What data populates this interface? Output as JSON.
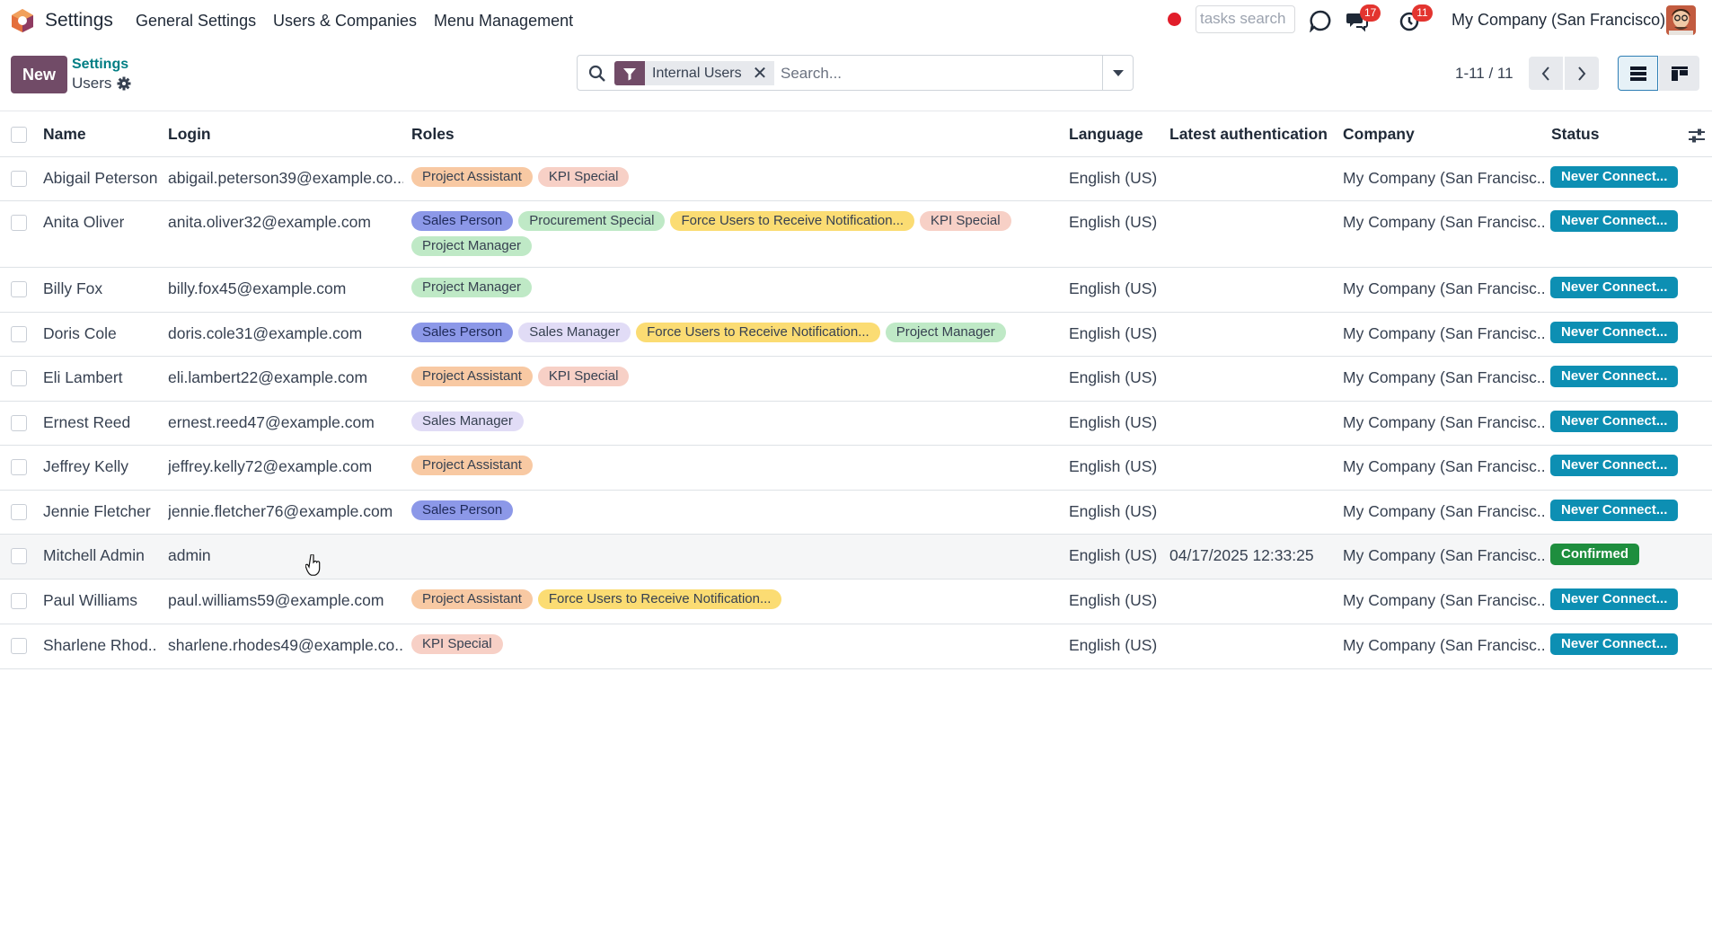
{
  "navbar": {
    "app_name": "Settings",
    "menus": [
      "General Settings",
      "Users & Companies",
      "Menu Management"
    ],
    "tasks_search_placeholder": "tasks search",
    "messages_count": "17",
    "activities_count": "11",
    "company": "My Company (San Francisco)"
  },
  "control_panel": {
    "new_label": "New",
    "breadcrumb": "Settings",
    "title": "Users",
    "facet_label": "Internal Users",
    "search_placeholder": "Search...",
    "pager": "1-11 / 11"
  },
  "columns": {
    "name": "Name",
    "login": "Login",
    "roles": "Roles",
    "language": "Language",
    "latest_auth": "Latest authentication",
    "company": "Company",
    "status": "Status"
  },
  "tag_colors": {
    "orange": "#f8c9a3",
    "salmon": "#f7d0c6",
    "blue": "#8c98e8",
    "green": "#bfe9c6",
    "yellow": "#fbdc73",
    "lavender": "#e1dcf6"
  },
  "status_colors": {
    "never": "#0d8fb3",
    "confirmed": "#1e8e3e"
  },
  "rows": [
    {
      "name": "Abigail Peterson",
      "login": "abigail.peterson39@example.co...",
      "roles": [
        {
          "label": "Project Assistant",
          "color": "orange"
        },
        {
          "label": "KPI Special",
          "color": "salmon"
        }
      ],
      "language": "English (US)",
      "latest_auth": "",
      "company": "My Company (San Francisc...",
      "status": "Never Connect...",
      "status_type": "never"
    },
    {
      "name": "Anita Oliver",
      "login": "anita.oliver32@example.com",
      "roles": [
        {
          "label": "Sales Person",
          "color": "blue"
        },
        {
          "label": "Procurement Special",
          "color": "green"
        },
        {
          "label": "Force Users to Receive Notification...",
          "color": "yellow"
        },
        {
          "label": "KPI Special",
          "color": "salmon"
        },
        {
          "label": "Project Manager",
          "color": "green"
        }
      ],
      "language": "English (US)",
      "latest_auth": "",
      "company": "My Company (San Francisc...",
      "status": "Never Connect...",
      "status_type": "never"
    },
    {
      "name": "Billy Fox",
      "login": "billy.fox45@example.com",
      "roles": [
        {
          "label": "Project Manager",
          "color": "green"
        }
      ],
      "language": "English (US)",
      "latest_auth": "",
      "company": "My Company (San Francisc...",
      "status": "Never Connect...",
      "status_type": "never"
    },
    {
      "name": "Doris Cole",
      "login": "doris.cole31@example.com",
      "roles": [
        {
          "label": "Sales Person",
          "color": "blue"
        },
        {
          "label": "Sales Manager",
          "color": "lavender"
        },
        {
          "label": "Force Users to Receive Notification...",
          "color": "yellow"
        },
        {
          "label": "Project Manager",
          "color": "green"
        }
      ],
      "language": "English (US)",
      "latest_auth": "",
      "company": "My Company (San Francisc...",
      "status": "Never Connect...",
      "status_type": "never"
    },
    {
      "name": "Eli Lambert",
      "login": "eli.lambert22@example.com",
      "roles": [
        {
          "label": "Project Assistant",
          "color": "orange"
        },
        {
          "label": "KPI Special",
          "color": "salmon"
        }
      ],
      "language": "English (US)",
      "latest_auth": "",
      "company": "My Company (San Francisc...",
      "status": "Never Connect...",
      "status_type": "never"
    },
    {
      "name": "Ernest Reed",
      "login": "ernest.reed47@example.com",
      "roles": [
        {
          "label": "Sales Manager",
          "color": "lavender"
        }
      ],
      "language": "English (US)",
      "latest_auth": "",
      "company": "My Company (San Francisc...",
      "status": "Never Connect...",
      "status_type": "never"
    },
    {
      "name": "Jeffrey Kelly",
      "login": "jeffrey.kelly72@example.com",
      "roles": [
        {
          "label": "Project Assistant",
          "color": "orange"
        }
      ],
      "language": "English (US)",
      "latest_auth": "",
      "company": "My Company (San Francisc...",
      "status": "Never Connect...",
      "status_type": "never"
    },
    {
      "name": "Jennie Fletcher",
      "login": "jennie.fletcher76@example.com",
      "roles": [
        {
          "label": "Sales Person",
          "color": "blue"
        }
      ],
      "language": "English (US)",
      "latest_auth": "",
      "company": "My Company (San Francisc...",
      "status": "Never Connect...",
      "status_type": "never"
    },
    {
      "name": "Mitchell Admin",
      "login": "admin",
      "roles": [],
      "language": "English (US)",
      "latest_auth": "04/17/2025 12:33:25",
      "company": "My Company (San Francisc...",
      "status": "Confirmed",
      "status_type": "confirmed",
      "hover": true
    },
    {
      "name": "Paul Williams",
      "login": "paul.williams59@example.com",
      "roles": [
        {
          "label": "Project Assistant",
          "color": "orange"
        },
        {
          "label": "Force Users to Receive Notification...",
          "color": "yellow"
        }
      ],
      "language": "English (US)",
      "latest_auth": "",
      "company": "My Company (San Francisc...",
      "status": "Never Connect...",
      "status_type": "never"
    },
    {
      "name": "Sharlene Rhod...",
      "login": "sharlene.rhodes49@example.co...",
      "roles": [
        {
          "label": "KPI Special",
          "color": "salmon"
        }
      ],
      "language": "English (US)",
      "latest_auth": "",
      "company": "My Company (San Francisc...",
      "status": "Never Connect...",
      "status_type": "never"
    }
  ]
}
